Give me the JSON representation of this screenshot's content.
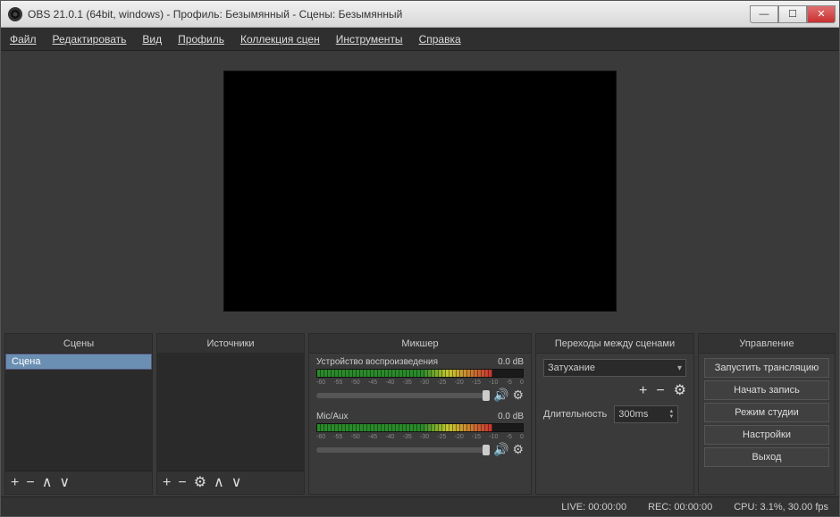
{
  "titlebar": {
    "title": "OBS 21.0.1 (64bit, windows) - Профиль: Безымянный - Сцены: Безымянный"
  },
  "menu": {
    "file": "Файл",
    "edit": "Редактировать",
    "view": "Вид",
    "profile": "Профиль",
    "scene_collection": "Коллекция сцен",
    "tools": "Инструменты",
    "help": "Справка"
  },
  "panels": {
    "scenes_title": "Сцены",
    "sources_title": "Источники",
    "mixer_title": "Микшер",
    "transitions_title": "Переходы между сценами",
    "controls_title": "Управление"
  },
  "scenes": {
    "items": [
      "Сцена"
    ]
  },
  "mixer": {
    "ch1": {
      "name": "Устройство воспроизведения",
      "db": "0.0 dB"
    },
    "ch2": {
      "name": "Mic/Aux",
      "db": "0.0 dB"
    },
    "ticks": [
      "-60",
      "-55",
      "-50",
      "-45",
      "-40",
      "-35",
      "-30",
      "-25",
      "-20",
      "-15",
      "-10",
      "-5",
      "0"
    ]
  },
  "transitions": {
    "selected": "Затухание",
    "duration_label": "Длительность",
    "duration_value": "300ms"
  },
  "controls": {
    "start_stream": "Запустить трансляцию",
    "start_record": "Начать запись",
    "studio_mode": "Режим студии",
    "settings": "Настройки",
    "exit": "Выход"
  },
  "statusbar": {
    "live": "LIVE: 00:00:00",
    "rec": "REC: 00:00:00",
    "cpu": "CPU: 3.1%, 30.00 fps"
  }
}
